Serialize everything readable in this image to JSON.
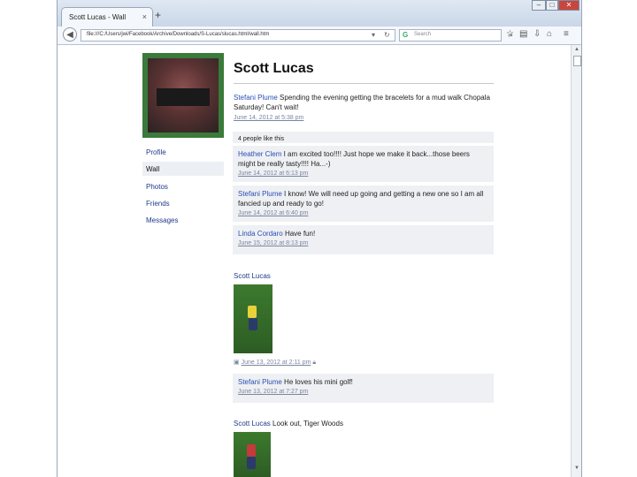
{
  "browser": {
    "tab_title": "Scott Lucas - Wall",
    "tab_close": "×",
    "new_tab": "+",
    "url": "file:///C:/Users/jwi/Facebook/Archive/Downloads/S-Lucas/slucas.html/wall.htm",
    "search_placeholder": "Search",
    "min": "–",
    "max": "□",
    "close": "✕"
  },
  "sidebar": {
    "nav": [
      {
        "label": "Profile"
      },
      {
        "label": "Wall"
      },
      {
        "label": "Photos"
      },
      {
        "label": "Friends"
      },
      {
        "label": "Messages"
      }
    ]
  },
  "profile": {
    "name": "Scott Lucas",
    "status": {
      "author": "Stefani Plume",
      "text": "Spending the evening getting the bracelets for a mud walk Chopala Saturday! Can't wait!",
      "time": "June 14, 2012 at 5:38 pm"
    },
    "likes": "4 people like this"
  },
  "comments": [
    {
      "author": "Heather Clem",
      "text": "I am excited too!!!! Just hope we make it back...those beers might be really tasty!!!! Ha...-)",
      "time": "June 14, 2012 at 6:13 pm"
    },
    {
      "author": "Stefani Plume",
      "text": "I know! We will need up going and getting a new one so I am all fancied up and ready to go!",
      "time": "June 14, 2012 at 6:40 pm"
    },
    {
      "author": "Linda Cordaro",
      "text": "Have fun!",
      "time": "June 15, 2012 at 8:13 pm"
    }
  ],
  "post2": {
    "author": "Scott Lucas",
    "time": "June 13, 2012 at 2:11 pm",
    "comment_author": "Stefani Plume",
    "comment_text": "He loves his mini golf!",
    "comment_time": "June 13, 2012 at 7:27 pm"
  },
  "post3": {
    "author": "Scott Lucas",
    "text": "Look out, Tiger Woods"
  },
  "icons": {
    "back": "back-arrow-icon",
    "refresh": "refresh-icon",
    "star": "star-icon",
    "menu": "menu-icon"
  }
}
